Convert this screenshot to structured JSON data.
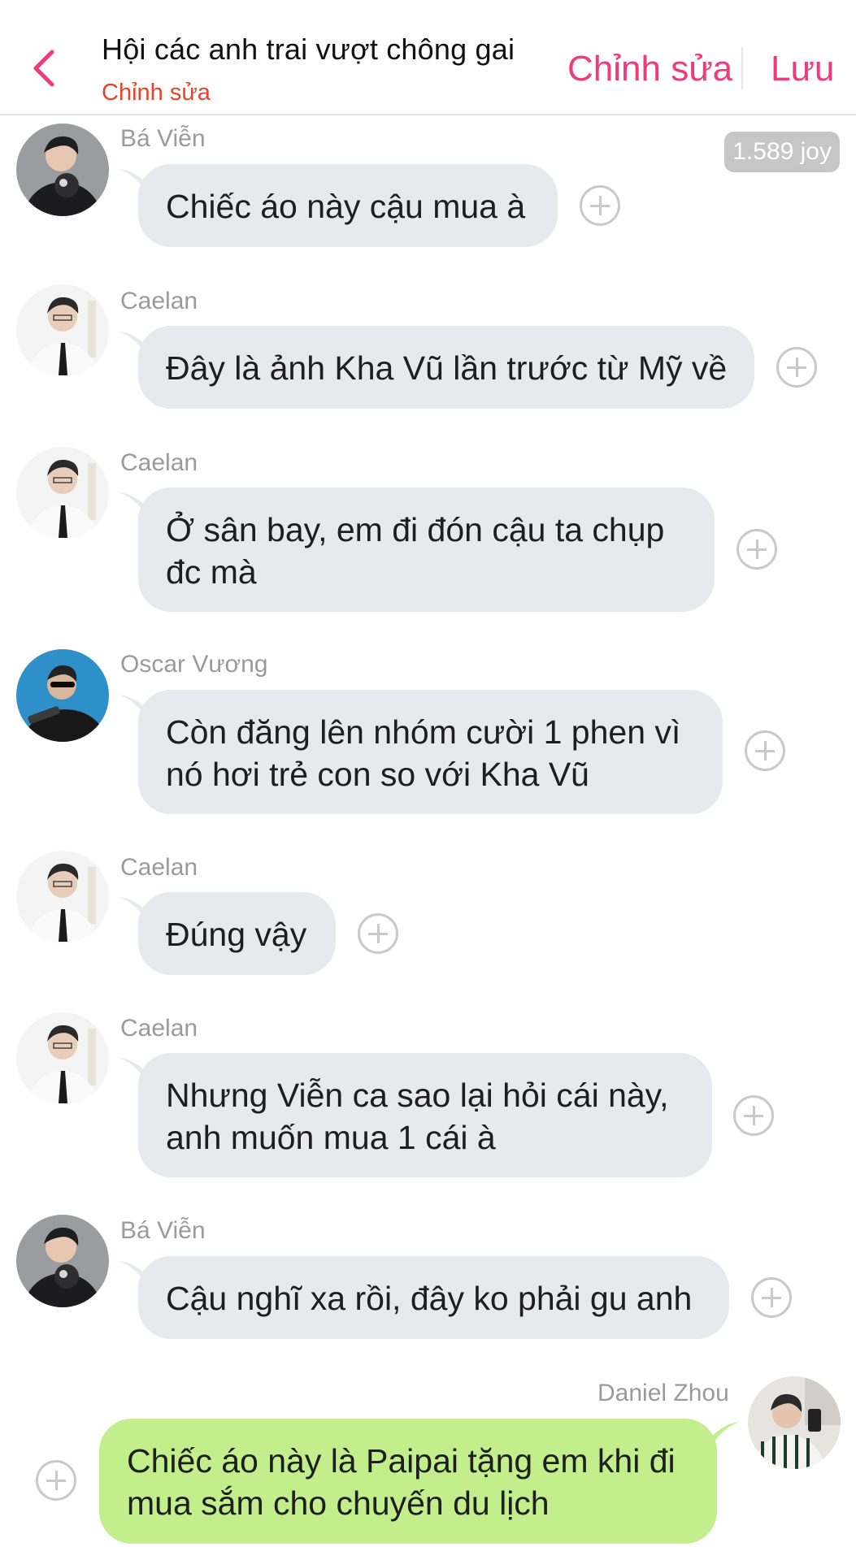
{
  "header": {
    "title": "Hội các anh trai vượt chông gai",
    "subtitle": "Chỉnh sửa",
    "edit_label": "Chỉnh sửa",
    "save_label": "Lưu",
    "accent_color": "#ee3b7c"
  },
  "badge": "1.589 joy",
  "messages": [
    {
      "sender": "Bá Viễn",
      "line1": "Chiếc áo này cậu mua à",
      "line2": ""
    },
    {
      "sender": "Caelan",
      "line1": "Đây là ảnh Kha Vũ lần trước từ Mỹ về",
      "line2": ""
    },
    {
      "sender": "Caelan",
      "line1": "Ở sân bay, em đi đón cậu ta chụp",
      "line2": "đc mà"
    },
    {
      "sender": "Oscar Vương",
      "line1": "Còn đăng lên nhóm cười 1 phen vì",
      "line2": "nó hơi trẻ con so với Kha Vũ"
    },
    {
      "sender": "Caelan",
      "line1": "Đúng vậy",
      "line2": ""
    },
    {
      "sender": "Caelan",
      "line1": "Nhưng Viễn ca sao lại hỏi cái này,",
      "line2": "anh muốn mua 1 cái à"
    },
    {
      "sender": "Bá Viễn",
      "line1": "Cậu nghĩ xa rồi, đây ko phải gu anh",
      "line2": ""
    },
    {
      "sender": "Daniel Zhou",
      "line1": "Chiếc áo này là Paipai tặng em khi đi",
      "line2": "mua sắm cho chuyến du lịch"
    }
  ]
}
